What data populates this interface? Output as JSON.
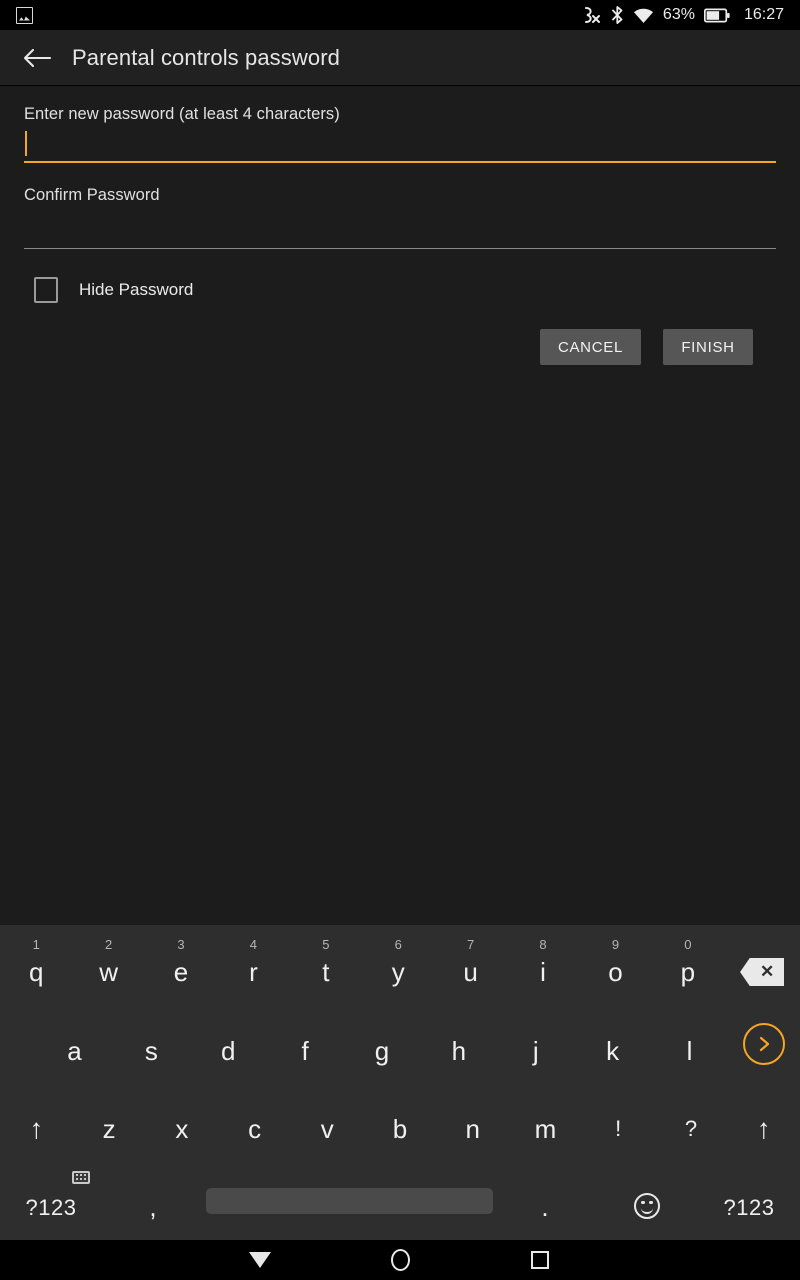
{
  "status_bar": {
    "notification_icon": "image-notification-icon",
    "icons": [
      "silent-mode-icon",
      "bluetooth-icon",
      "wifi-icon"
    ],
    "battery_percent": "63%",
    "battery_icon": "battery-icon",
    "time": "16:27"
  },
  "app_bar": {
    "back_icon": "arrow-back-icon",
    "title": "Parental controls password"
  },
  "form": {
    "new_password_label": "Enter new password (at least 4 characters)",
    "new_password_value": "",
    "new_password_placeholder": "",
    "confirm_password_label": "Confirm Password",
    "confirm_password_value": "",
    "confirm_password_placeholder": "",
    "hide_password_label": "Hide Password",
    "hide_password_checked": false,
    "cancel_label": "CANCEL",
    "finish_label": "FINISH",
    "accent_color": "#f5a623",
    "background_color": "#1c1c1c"
  },
  "keyboard": {
    "row1": [
      {
        "hint": "1",
        "key": "q"
      },
      {
        "hint": "2",
        "key": "w"
      },
      {
        "hint": "3",
        "key": "e"
      },
      {
        "hint": "4",
        "key": "r"
      },
      {
        "hint": "5",
        "key": "t"
      },
      {
        "hint": "6",
        "key": "y"
      },
      {
        "hint": "7",
        "key": "u"
      },
      {
        "hint": "8",
        "key": "i"
      },
      {
        "hint": "9",
        "key": "o"
      },
      {
        "hint": "0",
        "key": "p"
      }
    ],
    "backspace_icon": "backspace-icon",
    "backspace_glyph": "✕",
    "row2": [
      "a",
      "s",
      "d",
      "f",
      "g",
      "h",
      "j",
      "k",
      "l"
    ],
    "enter_icon": "chevron-right-enter-icon",
    "enter_glyph": "›",
    "row3": {
      "shift_left_icon": "shift-up-icon",
      "shift_glyph": "↑",
      "keys": [
        "z",
        "x",
        "c",
        "v",
        "b",
        "n",
        "m",
        "!",
        "?"
      ],
      "shift_right_icon": "shift-up-icon"
    },
    "row4": {
      "symbols_left": "?123",
      "comma": ",",
      "kbd_switch_icon": "keyboard-switch-icon",
      "space": "",
      "period": ".",
      "emoji_icon": "emoji-smiley-icon",
      "symbols_right": "?123"
    },
    "background_color": "#2e2e2e"
  },
  "nav_bar": {
    "back_icon": "nav-back-triangle-icon",
    "home_icon": "nav-home-circle-icon",
    "recents_icon": "nav-recents-square-icon"
  }
}
